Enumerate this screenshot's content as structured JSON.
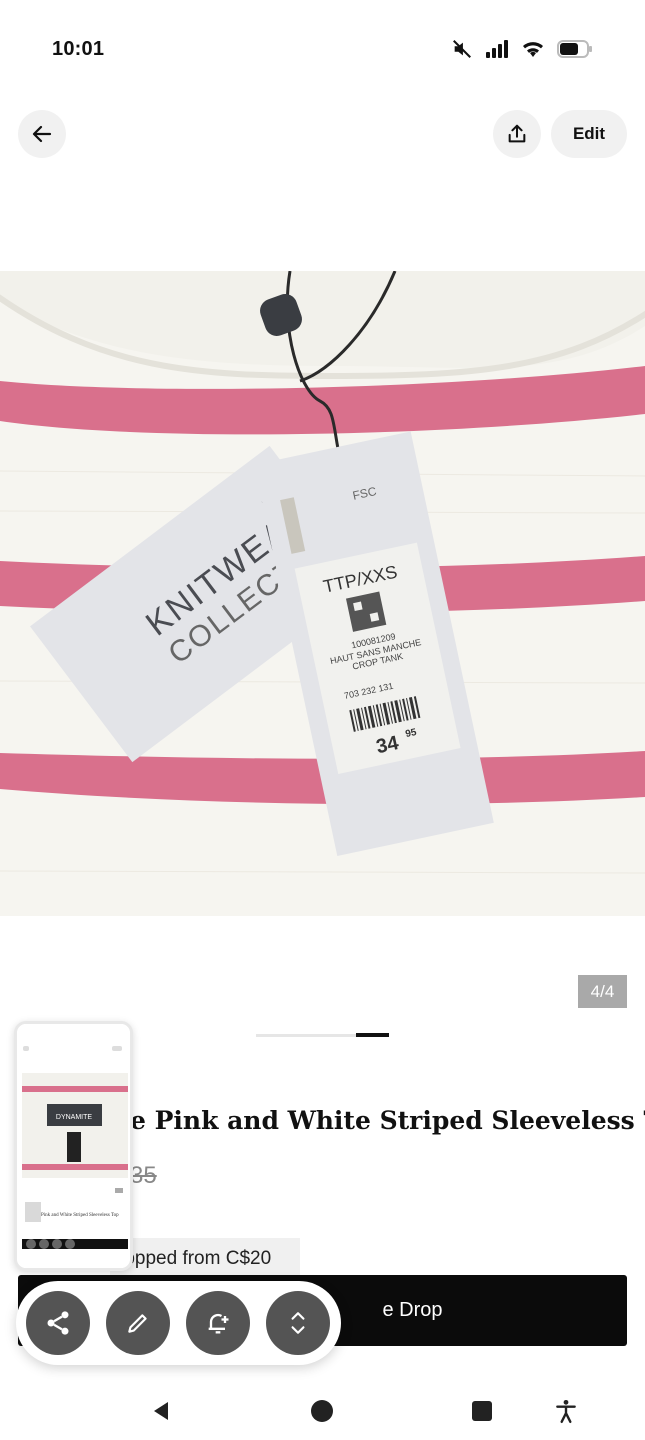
{
  "status_bar": {
    "time": "10:01"
  },
  "top_nav": {
    "edit_label": "Edit"
  },
  "product": {
    "image_counter": "4/4",
    "title_visible": "e Pink and White Striped Sleeveless Top",
    "price_old": "35",
    "price_drop_badge": "ropped from C$20",
    "primary_button_label": "e Drop"
  },
  "image_tags": {
    "brand_line1": "KNITWEAR",
    "brand_line2": "COLLECTION",
    "size": "TTP/XXS",
    "sku": "100081209",
    "desc_line1": "HAUT SANS MANCHE",
    "desc_line2": "CROP TANK",
    "code": "703 232 131",
    "price_main": "34",
    "price_cents": "95",
    "cert": "FSC"
  },
  "thumbnail": {
    "brand": "DYNAMITE",
    "title": "Pink and White Striped Sleeveless Top"
  },
  "colors": {
    "stripe_pink": "#d9708c",
    "fabric_white": "#f6f5f0",
    "button_black": "#0b0b0b",
    "toolbar_button": "#545454"
  },
  "icons": {
    "back": "arrow-left-icon",
    "share": "share-upload-icon",
    "tool_share": "share-nodes-icon",
    "tool_edit": "pencil-icon",
    "tool_alert": "bell-plus-icon",
    "tool_expand": "expand-vertical-icon",
    "nav_back": "triangle-back-icon",
    "nav_home": "circle-home-icon",
    "nav_recents": "square-recents-icon",
    "nav_accessibility": "accessibility-icon"
  }
}
